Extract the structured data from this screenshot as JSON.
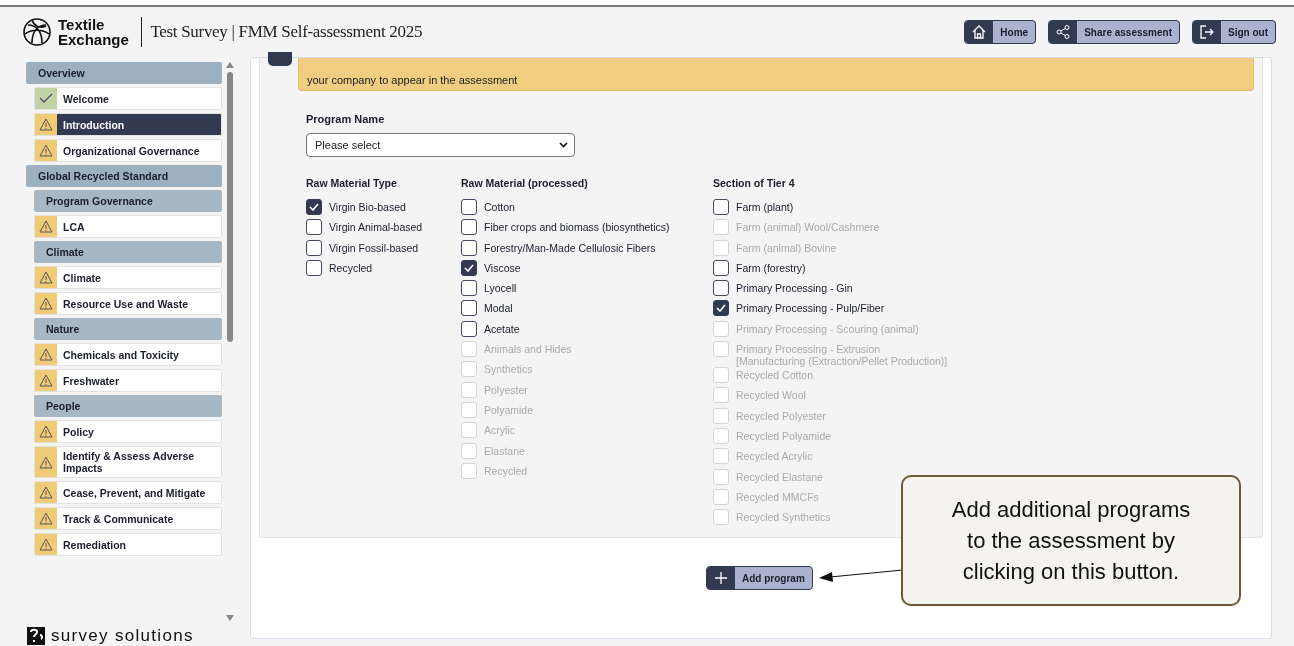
{
  "header": {
    "logo_lines": [
      "Textile",
      "Exchange"
    ],
    "title": "Test Survey | FMM Self-assessment 2025",
    "buttons": [
      {
        "label": "Home"
      },
      {
        "label": "Share assessment"
      },
      {
        "label": "Sign out"
      }
    ]
  },
  "sidebar": {
    "items": [
      {
        "kind": "section",
        "label": "Overview"
      },
      {
        "kind": "item",
        "label": "Welcome",
        "complete": true,
        "selected": false
      },
      {
        "kind": "item",
        "label": "Introduction",
        "complete": false,
        "selected": true
      },
      {
        "kind": "item",
        "label": "Organizational Governance",
        "complete": false,
        "selected": false
      },
      {
        "kind": "section",
        "label": "Global Recycled Standard"
      },
      {
        "kind": "subsection",
        "label": "Program Governance"
      },
      {
        "kind": "item",
        "label": "LCA",
        "complete": false,
        "selected": false
      },
      {
        "kind": "subsection",
        "label": "Climate"
      },
      {
        "kind": "item",
        "label": "Climate",
        "complete": false,
        "selected": false
      },
      {
        "kind": "item",
        "label": "Resource Use and Waste",
        "complete": false,
        "selected": false
      },
      {
        "kind": "subsection",
        "label": "Nature"
      },
      {
        "kind": "item",
        "label": "Chemicals and Toxicity",
        "complete": false,
        "selected": false
      },
      {
        "kind": "item",
        "label": "Freshwater",
        "complete": false,
        "selected": false
      },
      {
        "kind": "subsection",
        "label": "People"
      },
      {
        "kind": "item",
        "label": "Policy",
        "complete": false,
        "selected": false
      },
      {
        "kind": "item",
        "label": "Identify & Assess Adverse Impacts",
        "complete": false,
        "selected": false
      },
      {
        "kind": "item",
        "label": "Cease, Prevent, and Mitigate",
        "complete": false,
        "selected": false
      },
      {
        "kind": "item",
        "label": "Track & Communicate",
        "complete": false,
        "selected": false
      },
      {
        "kind": "item",
        "label": "Remediation",
        "complete": false,
        "selected": false
      }
    ],
    "footer": "survey solutions"
  },
  "notice": "your company to appear in the assessment",
  "program_name": {
    "label": "Program Name",
    "value": "Please select"
  },
  "groups": [
    {
      "title": "Raw Material Type",
      "options": [
        {
          "label": "Virgin Bio-based",
          "checked": true,
          "disabled": false
        },
        {
          "label": "Virgin Animal-based",
          "checked": false,
          "disabled": false
        },
        {
          "label": "Virgin Fossil-based",
          "checked": false,
          "disabled": false
        },
        {
          "label": "Recycled",
          "checked": false,
          "disabled": false
        }
      ]
    },
    {
      "title": "Raw Material (processed)",
      "options": [
        {
          "label": "Cotton",
          "checked": false,
          "disabled": false
        },
        {
          "label": "Fiber crops and biomass (biosynthetics)",
          "checked": false,
          "disabled": false
        },
        {
          "label": "Forestry/Man-Made Cellulosic Fibers",
          "checked": false,
          "disabled": false
        },
        {
          "label": "Viscose",
          "checked": true,
          "disabled": false
        },
        {
          "label": "Lyocell",
          "checked": false,
          "disabled": false
        },
        {
          "label": "Modal",
          "checked": false,
          "disabled": false
        },
        {
          "label": "Acetate",
          "checked": false,
          "disabled": false
        },
        {
          "label": "Animals and Hides",
          "checked": false,
          "disabled": true
        },
        {
          "label": "Synthetics",
          "checked": false,
          "disabled": true
        },
        {
          "label": "Polyester",
          "checked": false,
          "disabled": true
        },
        {
          "label": "Polyamide",
          "checked": false,
          "disabled": true
        },
        {
          "label": "Acrylic",
          "checked": false,
          "disabled": true
        },
        {
          "label": "Elastane",
          "checked": false,
          "disabled": true
        },
        {
          "label": "Recycled",
          "checked": false,
          "disabled": true
        }
      ]
    },
    {
      "title": "Section of Tier 4",
      "options": [
        {
          "label": "Farm (plant)",
          "checked": false,
          "disabled": false
        },
        {
          "label": "Farm (animal) Wool/Cashmere",
          "checked": false,
          "disabled": true
        },
        {
          "label": "Farm (animal) Bovine",
          "checked": false,
          "disabled": true
        },
        {
          "label": "Farm (forestry)",
          "checked": false,
          "disabled": false
        },
        {
          "label": "Primary Processing - Gin",
          "checked": false,
          "disabled": false
        },
        {
          "label": "Primary Processing - Pulp/Fiber",
          "checked": true,
          "disabled": false
        },
        {
          "label": "Primary Processing - Scouring (animal)",
          "checked": false,
          "disabled": true
        },
        {
          "label": "Primary Processing - Extrusion\n[Manufacturing (Extraction/Pellet Production)]",
          "checked": false,
          "disabled": true
        },
        {
          "label": "Recycled Cotton",
          "checked": false,
          "disabled": true
        },
        {
          "label": "Recycled Wool",
          "checked": false,
          "disabled": true
        },
        {
          "label": "Recycled Polyester",
          "checked": false,
          "disabled": true
        },
        {
          "label": "Recycled Polyamide",
          "checked": false,
          "disabled": true
        },
        {
          "label": "Recycled Acrylic",
          "checked": false,
          "disabled": true
        },
        {
          "label": "Recycled Elastane",
          "checked": false,
          "disabled": true
        },
        {
          "label": "Recycled MMCFs",
          "checked": false,
          "disabled": true
        },
        {
          "label": "Recycled Synthetics",
          "checked": false,
          "disabled": true
        }
      ]
    }
  ],
  "add_button": {
    "label": "Add program"
  },
  "callout": "Add additional programs to the assessment by clicking on this button."
}
